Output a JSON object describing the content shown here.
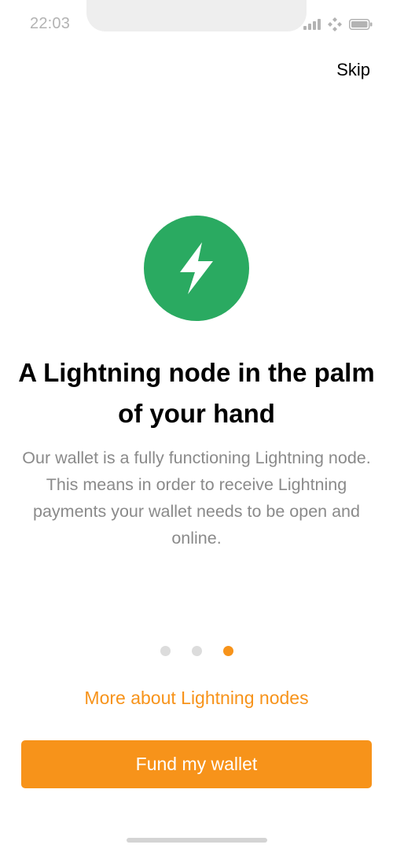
{
  "status_bar": {
    "time": "22:03",
    "icons": [
      "signal-icon",
      "wifi-icon",
      "battery-icon"
    ]
  },
  "header": {
    "skip_label": "Skip"
  },
  "hero": {
    "icon": "lightning-bolt-icon",
    "icon_bg_color": "#2aaa61",
    "title": "A Lightning node in the palm of your hand",
    "description": "Our wallet is a fully functioning Lightning node. This means in order to receive Lightning payments your wallet needs to be open and online."
  },
  "pagination": {
    "total": 3,
    "active_index": 2
  },
  "actions": {
    "more_link_label": "More about Lightning nodes",
    "fund_button_label": "Fund my wallet"
  },
  "colors": {
    "accent": "#f7931a",
    "muted_text": "#8a8a8a",
    "inactive_dot": "#dcdcdc"
  }
}
